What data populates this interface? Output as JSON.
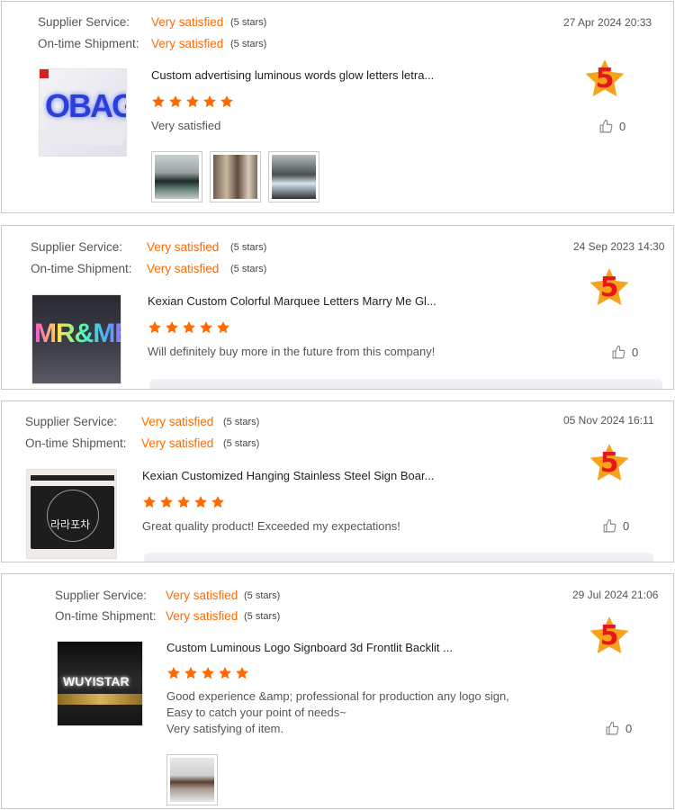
{
  "labels": {
    "supplier_service": "Supplier Service:",
    "ontime_shipment": "On-time Shipment:"
  },
  "colors": {
    "accent": "#ff6a00",
    "star": "#ff6a00",
    "badge_star": "#f7a21b",
    "badge_number": "#e5161d"
  },
  "reviews": [
    {
      "supplier_value": "Very satisfied",
      "supplier_stars": "(5 stars)",
      "shipment_value": "Very satisfied",
      "shipment_stars": "(5 stars)",
      "date": "27 Apr 2024 20:33",
      "product_title": "Custom advertising luminous words glow letters letra...",
      "product_image_text": "OBAGI",
      "rating": 5,
      "comment_lines": [
        "Very satisfied"
      ],
      "score": "5",
      "likes": "0",
      "attached_photos": 3
    },
    {
      "supplier_value": "Very satisfied",
      "supplier_stars": "(5 stars)",
      "shipment_value": "Very satisfied",
      "shipment_stars": "(5 stars)",
      "date": "24 Sep 2023 14:30",
      "product_title": "Kexian Custom Colorful Marquee Letters Marry Me Gl...",
      "product_image_text": "MR&ME",
      "rating": 5,
      "comment_lines": [
        "Will definitely buy more in the future from this company!"
      ],
      "score": "5",
      "likes": "0",
      "attached_photos": 0
    },
    {
      "supplier_value": "Very satisfied",
      "supplier_stars": "(5 stars)",
      "shipment_value": "Very satisfied",
      "shipment_stars": "(5 stars)",
      "date": "05 Nov 2024 16:11",
      "product_title": "Kexian Customized Hanging Stainless Steel Sign Boar...",
      "product_image_text": "라라포차",
      "rating": 5,
      "comment_lines": [
        "Great quality product! Exceeded my expectations!"
      ],
      "score": "5",
      "likes": "0",
      "attached_photos": 0
    },
    {
      "supplier_value": "Very satisfied",
      "supplier_stars": "(5 stars)",
      "shipment_value": "Very satisfied",
      "shipment_stars": "(5 stars)",
      "date": "29 Jul 2024 21:06",
      "product_title": "Custom Luminous Logo Signboard 3d Frontlit Backlit ...",
      "product_image_text": "WUYISTAR",
      "rating": 5,
      "comment_lines": [
        "Good experience &amp; professional for production any logo sign,",
        "Easy to catch your point of needs~",
        "Very satisfying of item."
      ],
      "score": "5",
      "likes": "0",
      "attached_photos": 1
    }
  ]
}
